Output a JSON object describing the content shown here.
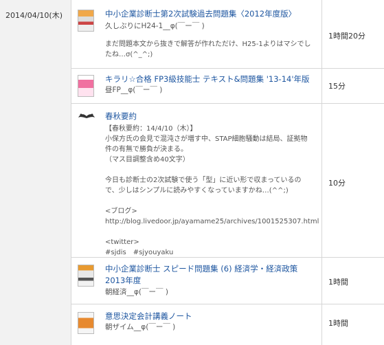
{
  "date": "2014/04/10(木)",
  "entries": [
    {
      "title": "中小企業診断士第2次試験過去問題集〈2012年度版〉",
      "sub": "久しぶりにH24-1__φ(￣ー￣ )",
      "desc": "まだ問題本文から抜きで解答が作れただけ、H25-1よりはマシでしたね…σ(^_^;)",
      "time": "1時間20分",
      "icon": "book-cover-icon"
    },
    {
      "title": "キラリ☆合格 FP3級技能士 テキスト&問題集 '13-14'年版",
      "sub": "昼FP__φ(￣ー￣ )",
      "desc": "",
      "time": "15分",
      "icon": "book-cover-icon"
    },
    {
      "title": "春秋要約",
      "sub": "",
      "desc": "【春秋要約：14/4/10（木）】\n小保方氏の会見で混沌さが増す中、STAP細胞騒動は結局、証拠物件の有無で勝負が決まる。\n（マス目調整含め40文字）\n\n今日も診断士の2次試験で使う「型」に近い形で収まっているので、少しはシンプルに読みやすくなっていますかね…(^^;)\n\n<ブログ>\nhttp://blog.livedoor.jp/ayamame25/archives/1001525307.html\n\n<twitter>\n#sjdis　#sjyouyaku",
      "time": "10分",
      "icon": "mustache-icon"
    },
    {
      "title": "中小企業診断士 スピード問題集 (6) 経済学・経済政策 2013年度",
      "sub": "朝経済__φ(￣ー￣ )",
      "desc": "",
      "time": "1時間",
      "icon": "book-cover-icon"
    },
    {
      "title": "意思決定会計講義ノート",
      "sub": "朝ザイム__φ(￣ー￣ )",
      "desc": "",
      "time": "1時間",
      "icon": "book-cover-icon"
    }
  ]
}
